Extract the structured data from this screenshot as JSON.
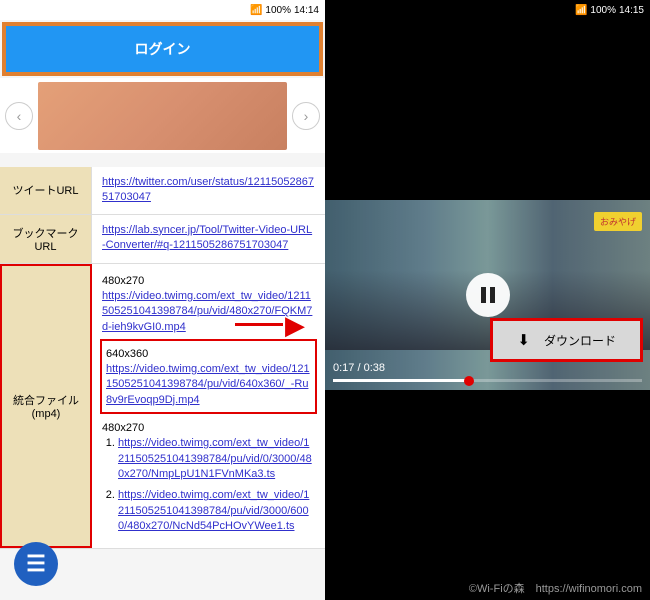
{
  "left": {
    "status": {
      "battery": "100%",
      "time": "14:14"
    },
    "login_label": "ログイン",
    "rows": {
      "tweet_url": {
        "label": "ツイートURL",
        "link": "https://twitter.com/user/status/1211505286751703047"
      },
      "bookmark_url": {
        "label": "ブックマークURL",
        "link": "https://lab.syncer.jp/Tool/Twitter-Video-URL-Converter/#q-1211505286751703047"
      },
      "mp4": {
        "label": "統合ファイル (mp4)",
        "item1": {
          "res": "480x270",
          "link": "https://video.twimg.com/ext_tw_video/1211505251041398784/pu/vid/480x270/FQKM7d-ieh9kvGI0.mp4"
        },
        "item2": {
          "res": "640x360",
          "link": "https://video.twimg.com/ext_tw_video/1211505251041398784/pu/vid/640x360/_-Ru8v9rEvoqp9Dj.mp4"
        },
        "item3": {
          "res": "480x270",
          "link1": "https://video.twimg.com/ext_tw_video/1211505251041398784/pu/vid/0/3000/480x270/NmpLpU1N1FVnMKa3.ts",
          "link2": "https://video.twimg.com/ext_tw_video/1211505251041398784/pu/vid/3000/6000/480x270/NcNd54PcHOvYWee1.ts"
        }
      }
    }
  },
  "right": {
    "status": {
      "battery": "100%",
      "time": "14:15"
    },
    "souvenir": "おみやげ",
    "time_display": "0:17 / 0:38",
    "download_label": "ダウンロード"
  },
  "watermark": "©Wi-Fiの森　https://wifinomori.com"
}
